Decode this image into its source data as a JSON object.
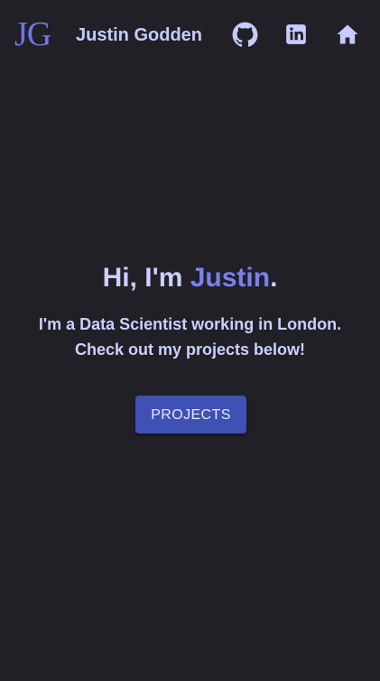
{
  "header": {
    "logo_text": "JG",
    "site_name": "Justin Godden",
    "icons": [
      "github-icon",
      "linkedin-icon",
      "home-icon"
    ]
  },
  "hero": {
    "greeting_prefix": "Hi, I'm",
    "greeting_name": "Justin",
    "greeting_suffix": ".",
    "subtitle_line_1": "I'm a Data Scientist working in London.",
    "subtitle_line_2": "Check out my projects below!",
    "button_label": "PROJECTS"
  },
  "colors": {
    "background": "#202026",
    "accent": "#7077e6",
    "text": "#cdd0ff",
    "button": "#3f51b5"
  }
}
